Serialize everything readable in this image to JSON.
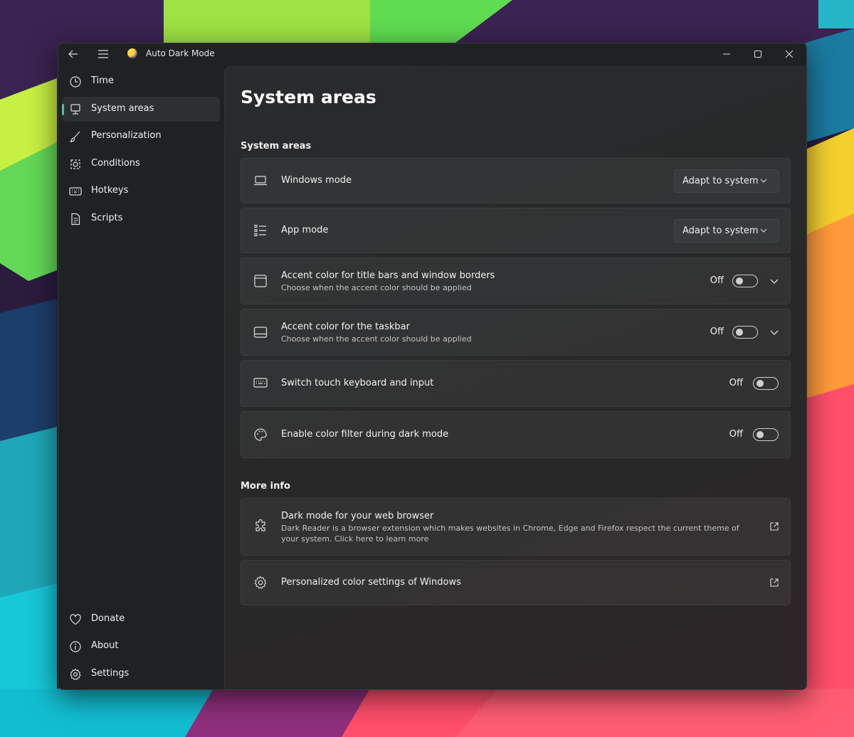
{
  "window": {
    "title": "Auto Dark Mode"
  },
  "sidebar": {
    "items": [
      {
        "label": "Time",
        "icon": "clock-icon",
        "active": false
      },
      {
        "label": "System areas",
        "icon": "computer-icon",
        "active": true
      },
      {
        "label": "Personalization",
        "icon": "brush-icon",
        "active": false
      },
      {
        "label": "Conditions",
        "icon": "conditions-icon",
        "active": false
      },
      {
        "label": "Hotkeys",
        "icon": "keyboard-icon",
        "active": false
      },
      {
        "label": "Scripts",
        "icon": "document-icon",
        "active": false
      }
    ],
    "footer_items": [
      {
        "label": "Donate",
        "icon": "heart-icon"
      },
      {
        "label": "About",
        "icon": "info-icon"
      },
      {
        "label": "Settings",
        "icon": "gear-icon"
      }
    ]
  },
  "main": {
    "page_title": "System areas",
    "sections": {
      "system_areas": {
        "title": "System areas",
        "cards": [
          {
            "title": "Windows mode",
            "icon": "laptop-icon",
            "control": "dropdown",
            "value": "Adapt to system"
          },
          {
            "title": "App mode",
            "icon": "list-icon",
            "control": "dropdown",
            "value": "Adapt to system"
          },
          {
            "title": "Accent color for title bars and window borders",
            "subtitle": "Choose when the accent color should be applied",
            "icon": "window-icon",
            "control": "toggle-expander",
            "state": "Off"
          },
          {
            "title": "Accent color for the taskbar",
            "subtitle": "Choose when the accent color should be applied",
            "icon": "taskbar-icon",
            "control": "toggle-expander",
            "state": "Off"
          },
          {
            "title": "Switch touch keyboard and input",
            "icon": "keyboard-icon",
            "control": "toggle",
            "state": "Off"
          },
          {
            "title": "Enable color filter during dark mode",
            "icon": "palette-icon",
            "control": "toggle",
            "state": "Off"
          }
        ]
      },
      "more_info": {
        "title": "More info",
        "cards": [
          {
            "title": "Dark mode for your web browser",
            "subtitle": "Dark Reader is a browser extension which makes websites in Chrome, Edge and Firefox respect the current theme of your system. Click here to learn more",
            "icon": "puzzle-icon"
          },
          {
            "title": "Personalized color settings of Windows",
            "icon": "gear-icon"
          }
        ]
      }
    }
  },
  "colors": {
    "accent": "#4cc2a0",
    "window_bg": "#1f2123",
    "card_bg": "#303234"
  }
}
